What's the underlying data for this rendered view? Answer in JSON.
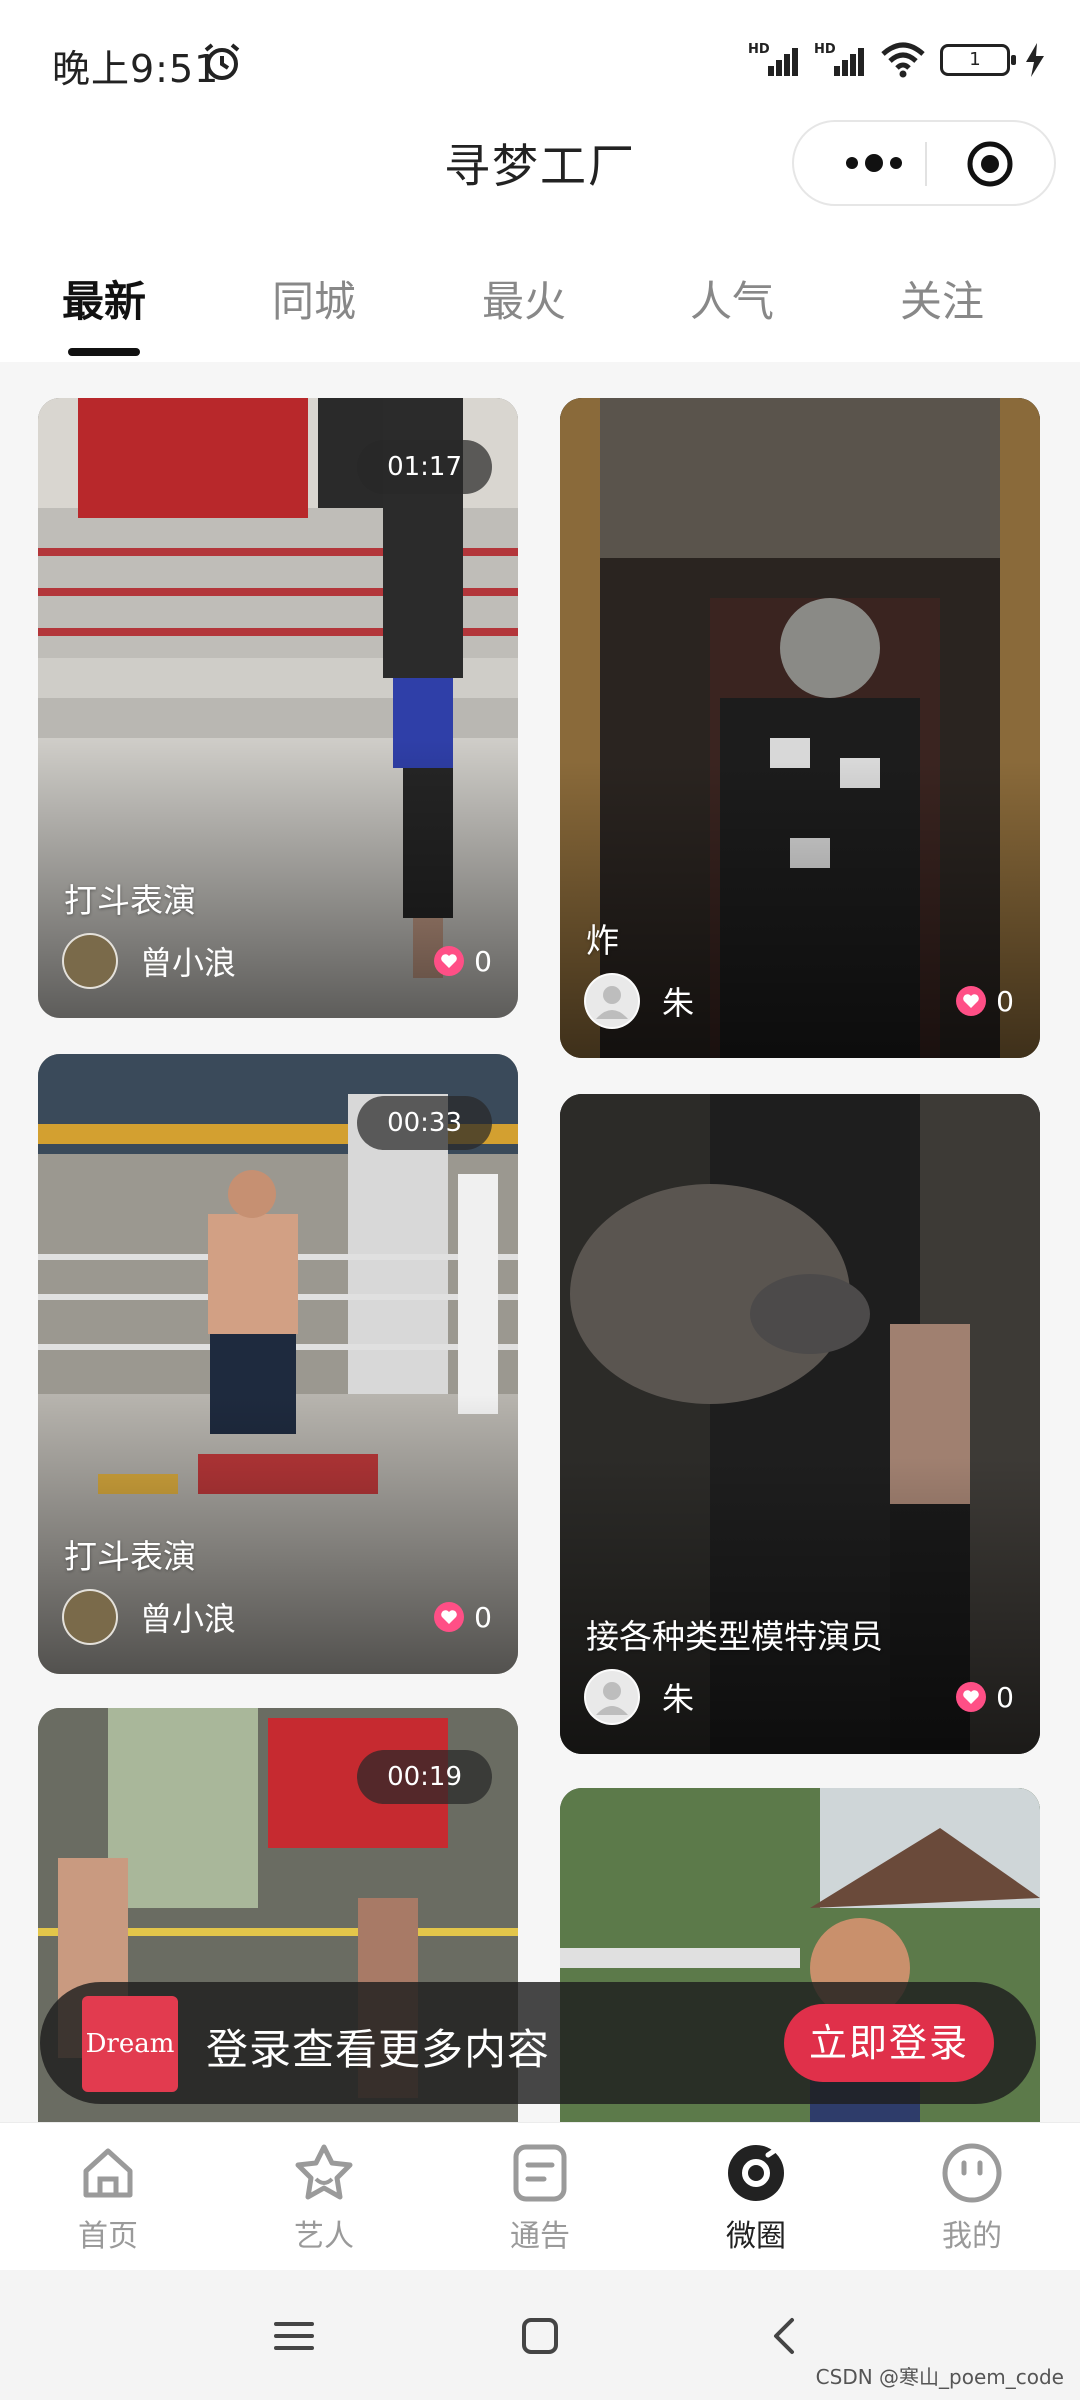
{
  "status_bar": {
    "time": "晚上9:51",
    "battery": "1",
    "network_1": "HD",
    "network_2": "HD"
  },
  "nav": {
    "title": "寻梦工厂"
  },
  "tabs": [
    {
      "label": "最新",
      "active": true
    },
    {
      "label": "同城",
      "active": false
    },
    {
      "label": "最火",
      "active": false
    },
    {
      "label": "人气",
      "active": false
    },
    {
      "label": "关注",
      "active": false
    }
  ],
  "feed": {
    "left": [
      {
        "duration": "01:17",
        "title": "打斗表演",
        "author": "曾小浪",
        "likes": "0"
      },
      {
        "duration": "00:33",
        "title": "打斗表演",
        "author": "曾小浪",
        "likes": "0"
      },
      {
        "duration": "00:19"
      }
    ],
    "right": [
      {
        "title": "炸",
        "author": "朱",
        "likes": "0"
      },
      {
        "title": "接各种类型模特演员",
        "author": "朱",
        "likes": "0"
      },
      {}
    ]
  },
  "login_banner": {
    "logo_text": "Dream",
    "text": "登录查看更多内容",
    "button": "立即登录"
  },
  "tabbar": [
    {
      "label": "首页",
      "icon": "home-icon"
    },
    {
      "label": "艺人",
      "icon": "star-person-icon"
    },
    {
      "label": "通告",
      "icon": "notice-icon"
    },
    {
      "label": "微圈",
      "icon": "circle-icon",
      "active": true
    },
    {
      "label": "我的",
      "icon": "smiley-icon"
    }
  ],
  "watermark": "CSDN @寒山_poem_code",
  "colors": {
    "accent": "#e0304a",
    "heart": "#ff4f86"
  }
}
